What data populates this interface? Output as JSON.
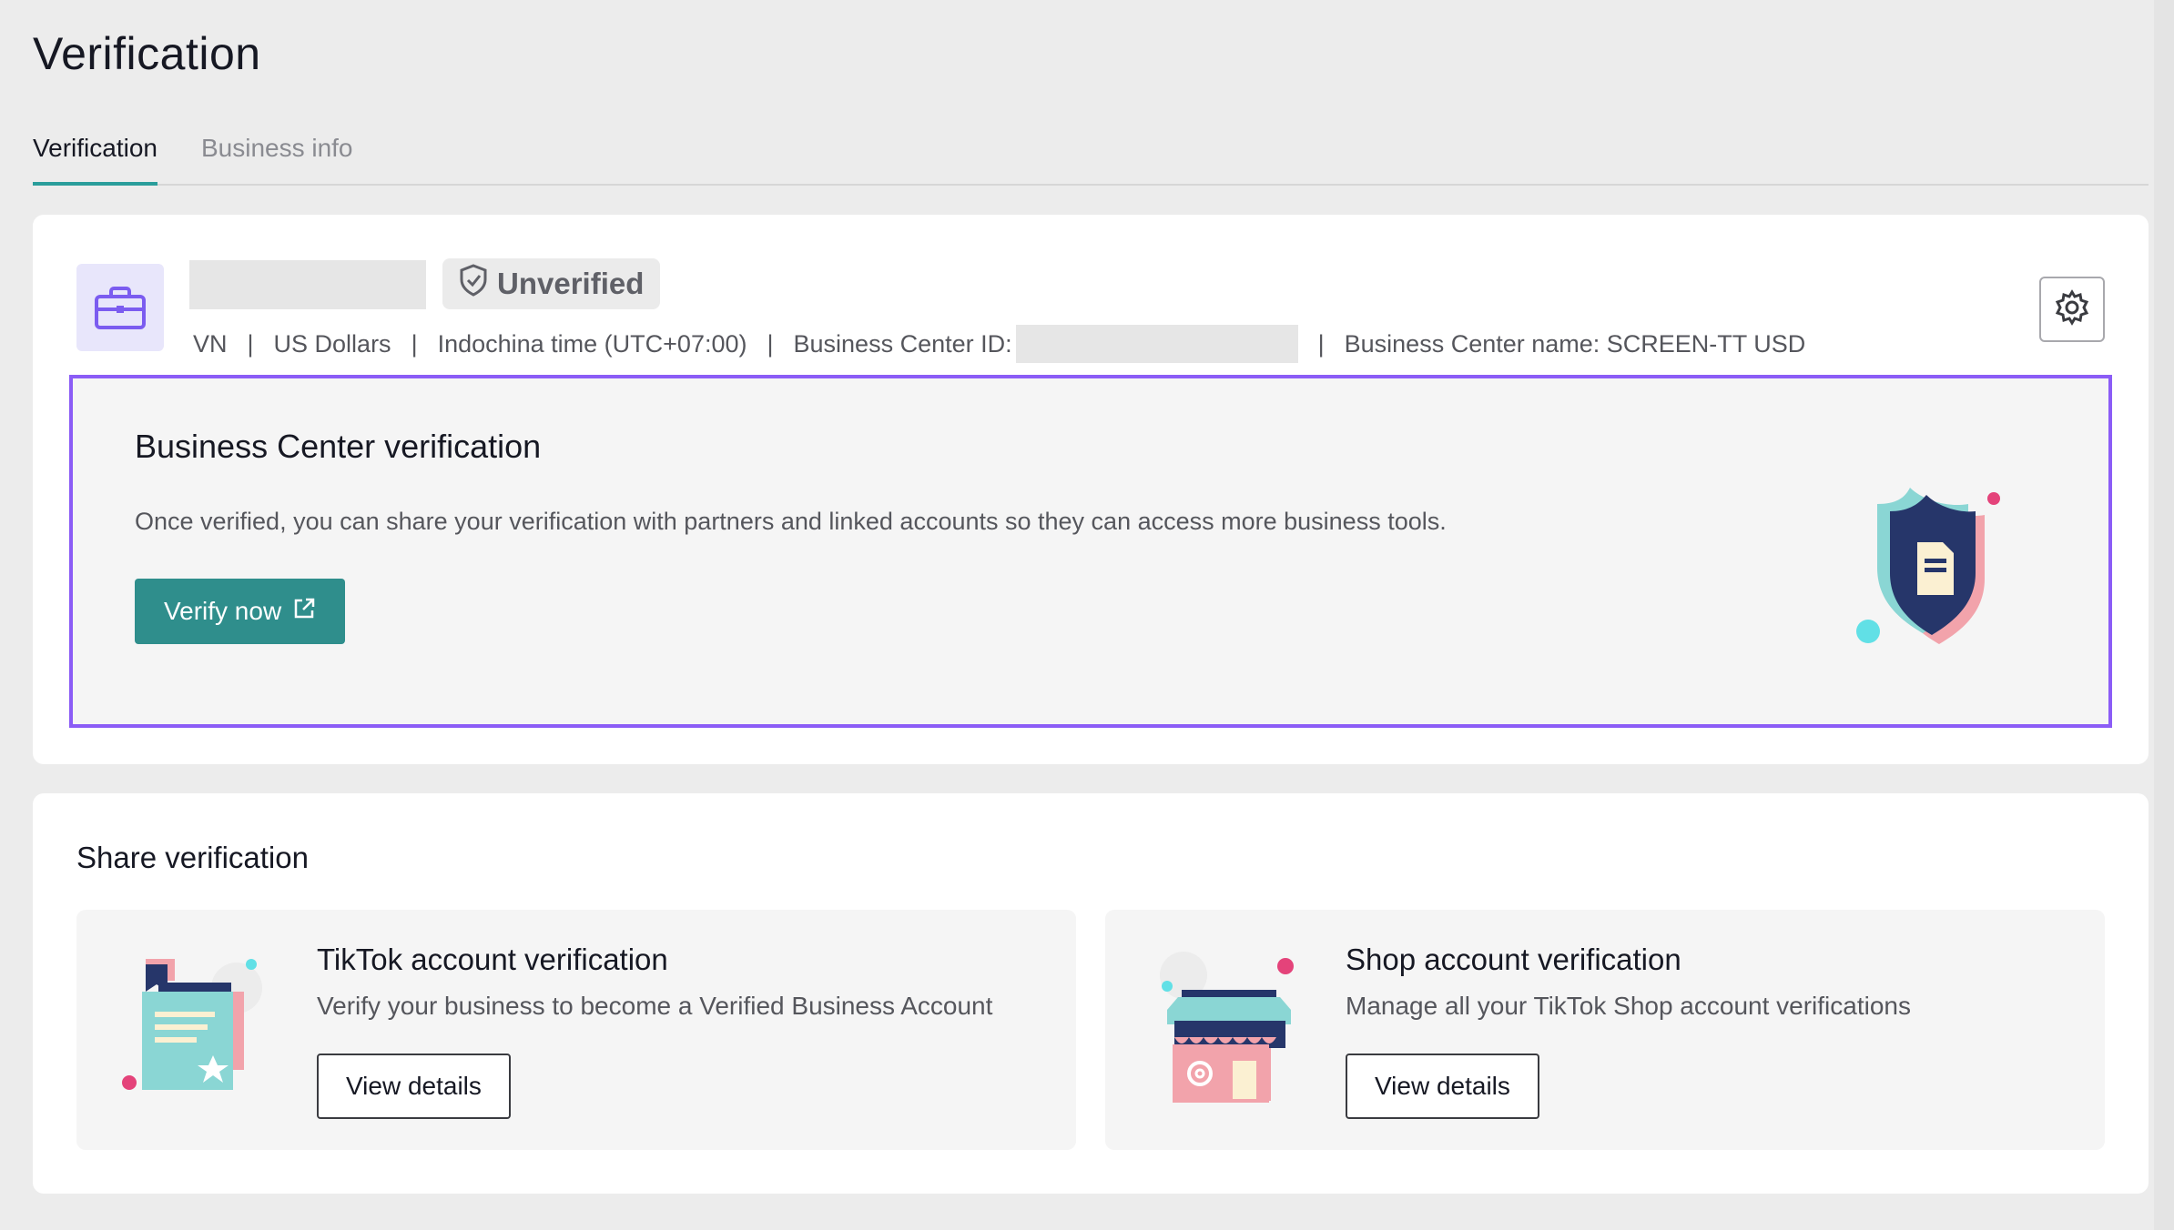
{
  "page": {
    "title": "Verification"
  },
  "tabs": [
    {
      "label": "Verification",
      "active": true
    },
    {
      "label": "Business info",
      "active": false
    }
  ],
  "business": {
    "status": "Unverified",
    "country": "VN",
    "currency": "US Dollars",
    "timezone": "Indochina time (UTC+07:00)",
    "id_label": "Business Center ID:",
    "name_label": "Business Center name: SCREEN-TT USD",
    "separator": "|",
    "icon": "briefcase-icon",
    "settings_icon": "gear-icon"
  },
  "bc_verification": {
    "title": "Business Center verification",
    "description": "Once verified, you can share your verification with partners and linked accounts so they can access more business tools.",
    "button_label": "Verify now",
    "button_icon": "external-link-icon"
  },
  "share": {
    "title": "Share verification",
    "cards": [
      {
        "title": "TikTok account verification",
        "description": "Verify your business to become a Verified Business Account",
        "button_label": "View details"
      },
      {
        "title": "Shop account verification",
        "description": "Manage all your TikTok Shop account verifications",
        "button_label": "View details"
      }
    ]
  },
  "colors": {
    "accent": "#2f8e8c",
    "tab_underline": "#2a9d9b",
    "highlight_border": "#8b5cf6",
    "background": "#ececec"
  }
}
